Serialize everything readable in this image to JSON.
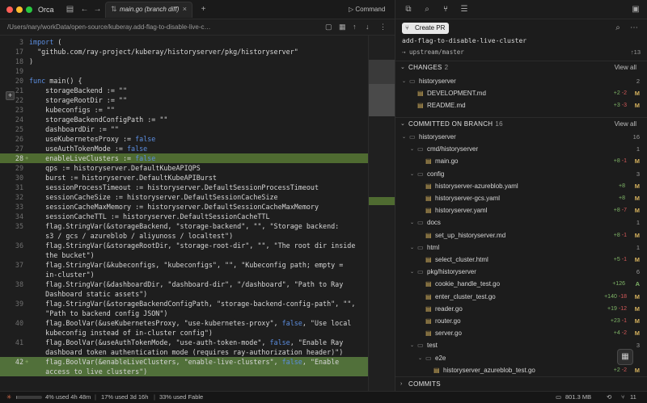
{
  "window": {
    "app_name": "Orca",
    "colors": {
      "close": "#ff5f57",
      "minimize": "#febc2e",
      "maximize": "#28c840"
    }
  },
  "tab": {
    "label": "main.go (branch diff)"
  },
  "command": {
    "label": "Command"
  },
  "editor": {
    "path": "/Users/nary/workData/open-source/kuberay.add-flag-to-disable-live-c…",
    "lines": [
      {
        "n": "3",
        "text": "import ("
      },
      {
        "n": "17",
        "text": "  \"github.com/ray-project/kuberay/historyserver/pkg/historyserver\""
      },
      {
        "n": "18",
        "text": ")"
      },
      {
        "n": "19",
        "text": ""
      },
      {
        "n": "20",
        "text": "func main() {"
      },
      {
        "n": "21",
        "text": "    storageBackend := \"\""
      },
      {
        "n": "22",
        "text": "    storageRootDir := \"\""
      },
      {
        "n": "23",
        "text": "    kubeconfigs := \"\""
      },
      {
        "n": "24",
        "text": "    storageBackendConfigPath := \"\""
      },
      {
        "n": "25",
        "text": "    dashboardDir := \"\""
      },
      {
        "n": "26",
        "text": "    useKubernetesProxy := false"
      },
      {
        "n": "27",
        "text": "    useAuthTokenMode := false"
      },
      {
        "n": "28",
        "text": "    enableLiveClusters := false"
      },
      {
        "n": "29",
        "text": "    qps := historyserver.DefaultKubeAPIQPS"
      },
      {
        "n": "30",
        "text": "    burst := historyserver.DefaultKubeAPIBurst"
      },
      {
        "n": "31",
        "text": "    sessionProcessTimeout := historyserver.DefaultSessionProcessTimeout"
      },
      {
        "n": "32",
        "text": "    sessionCacheSize := historyserver.DefaultSessionCacheSize"
      },
      {
        "n": "33",
        "text": "    sessionCacheMaxMemory := historyserver.DefaultSessionCacheMaxMemory"
      },
      {
        "n": "34",
        "text": "    sessionCacheTTL := historyserver.DefaultSessionCacheTTL"
      },
      {
        "n": "35",
        "text": "    flag.StringVar(&storageBackend, \"storage-backend\", \"\", \"Storage backend:"
      },
      {
        "n": "",
        "text": "    s3 / gcs / azureblob / aliyunoss / localtest\")"
      },
      {
        "n": "36",
        "text": "    flag.StringVar(&storageRootDir, \"storage-root-dir\", \"\", \"The root dir inside"
      },
      {
        "n": "",
        "text": "    the bucket\")"
      },
      {
        "n": "37",
        "text": "    flag.StringVar(&kubeconfigs, \"kubeconfigs\", \"\", \"Kubeconfig path; empty ="
      },
      {
        "n": "",
        "text": "    in-cluster\")"
      },
      {
        "n": "38",
        "text": "    flag.StringVar(&dashboardDir, \"dashboard-dir\", \"/dashboard\", \"Path to Ray"
      },
      {
        "n": "",
        "text": "    Dashboard static assets\")"
      },
      {
        "n": "39",
        "text": "    flag.StringVar(&storageBackendConfigPath, \"storage-backend-config-path\", \"\","
      },
      {
        "n": "",
        "text": "    \"Path to backend config JSON\")"
      },
      {
        "n": "40",
        "text": "    flag.BoolVar(&useKubernetesProxy, \"use-kubernetes-proxy\", false, \"Use local"
      },
      {
        "n": "",
        "text": "    kubeconfig instead of in-cluster config\")"
      },
      {
        "n": "41",
        "text": "    flag.BoolVar(&useAuthTokenMode, \"use-auth-token-mode\", false, \"Enable Ray"
      },
      {
        "n": "",
        "text": "    dashboard token authentication mode (requires ray-authorization header)\")"
      },
      {
        "n": "42",
        "text": "    flag.BoolVar(&enableLiveClusters, \"enable-live-clusters\", false, \"Enable"
      },
      {
        "n": "",
        "text": "    access to live clusters\")"
      }
    ]
  },
  "panel": {
    "create_pr": "Create PR",
    "branch": "add-flag-to-disable-live-cluster",
    "upstream": "upstream/master",
    "upstream_count": "↑13",
    "changes": {
      "title": "CHANGES",
      "count": "2",
      "view_all": "View all"
    },
    "committed": {
      "title": "COMMITTED ON BRANCH",
      "count": "16",
      "view_all": "View all"
    },
    "commits": {
      "title": "COMMITS"
    }
  },
  "changes_rows": [
    {
      "type": "folder",
      "indent": 0,
      "name": "historyserver",
      "count": "2"
    },
    {
      "type": "file",
      "indent": 1,
      "name": "DEVELOPMENT.md",
      "add": "+2",
      "del": "-2",
      "status": "M"
    },
    {
      "type": "file",
      "indent": 1,
      "name": "README.md",
      "add": "+3",
      "del": "-3",
      "status": "M"
    }
  ],
  "committed_rows": [
    {
      "type": "folder",
      "indent": 0,
      "name": "historyserver",
      "count": "16"
    },
    {
      "type": "folder",
      "indent": 1,
      "name": "cmd/historyserver",
      "count": "1"
    },
    {
      "type": "file",
      "indent": 2,
      "name": "main.go",
      "add": "+8",
      "del": "-1",
      "status": "M"
    },
    {
      "type": "folder",
      "indent": 1,
      "name": "config",
      "count": "3"
    },
    {
      "type": "file",
      "indent": 2,
      "name": "historyserver-azureblob.yaml",
      "add": "+8",
      "del": "",
      "status": "M"
    },
    {
      "type": "file",
      "indent": 2,
      "name": "historyserver-gcs.yaml",
      "add": "+8",
      "del": "",
      "status": "M"
    },
    {
      "type": "file",
      "indent": 2,
      "name": "historyserver.yaml",
      "add": "+8",
      "del": "-7",
      "status": "M"
    },
    {
      "type": "folder",
      "indent": 1,
      "name": "docs",
      "count": "1"
    },
    {
      "type": "file",
      "indent": 2,
      "name": "set_up_historyserver.md",
      "add": "+8",
      "del": "-1",
      "status": "M"
    },
    {
      "type": "folder",
      "indent": 1,
      "name": "html",
      "count": "1"
    },
    {
      "type": "file",
      "indent": 2,
      "name": "select_cluster.html",
      "add": "+5",
      "del": "-1",
      "status": "M"
    },
    {
      "type": "folder",
      "indent": 1,
      "name": "pkg/historyserver",
      "count": "6"
    },
    {
      "type": "file",
      "indent": 2,
      "name": "cookie_handle_test.go",
      "add": "+126",
      "del": "",
      "status": "A"
    },
    {
      "type": "file",
      "indent": 2,
      "name": "enter_cluster_test.go",
      "add": "+140",
      "del": "-18",
      "status": "M"
    },
    {
      "type": "file",
      "indent": 2,
      "name": "reader.go",
      "add": "+19",
      "del": "-12",
      "status": "M"
    },
    {
      "type": "file",
      "indent": 2,
      "name": "router.go",
      "add": "+23",
      "del": "-1",
      "status": "M"
    },
    {
      "type": "file",
      "indent": 2,
      "name": "server.go",
      "add": "+4",
      "del": "-2",
      "status": "M"
    },
    {
      "type": "folder",
      "indent": 1,
      "name": "test",
      "count": "3"
    },
    {
      "type": "folder",
      "indent": 2,
      "name": "e2e",
      "count": ""
    },
    {
      "type": "file",
      "indent": 3,
      "name": "historyserver_azureblob_test.go",
      "add": "+2",
      "del": "-2",
      "status": "M"
    }
  ],
  "statusbar": {
    "usage1": "4% used 4h 48m",
    "usage1_fraction": 0.04,
    "usage2": "17% used 3d 16h",
    "usage2_fraction": 0.17,
    "usage3": "33% used Fable",
    "memory": "801.3 MB",
    "count": "11"
  }
}
